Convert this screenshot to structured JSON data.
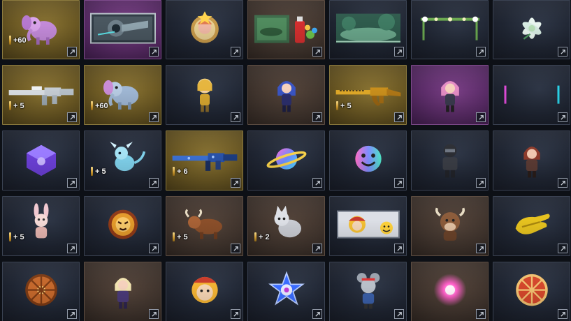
{
  "colors": {
    "tier_blue": "#1f2532",
    "tier_gold": "#6d5a24",
    "tier_purple": "#5b2c68",
    "tier_brown": "#41352e",
    "quantity_text": "#f2f2f2"
  },
  "items": [
    {
      "tier": "gold",
      "icon": "pink-elephant-pet-icon",
      "quantity": "+60"
    },
    {
      "tier": "purple",
      "icon": "weapon-crate-image-icon",
      "quantity": ""
    },
    {
      "tier": "blue",
      "icon": "character-medal-badge-icon",
      "quantity": ""
    },
    {
      "tier": "brown",
      "icon": "graffiti-spray-icon",
      "quantity": ""
    },
    {
      "tier": "blue",
      "icon": "forest-background-icon",
      "quantity": ""
    },
    {
      "tier": "blue",
      "icon": "flower-banner-icon",
      "quantity": ""
    },
    {
      "tier": "blue",
      "icon": "white-flower-icon",
      "quantity": ""
    },
    {
      "tier": "gold",
      "icon": "assault-rifle-white-icon",
      "quantity": "+ 5"
    },
    {
      "tier": "gold",
      "icon": "blue-elephant-pet-icon",
      "quantity": "+60"
    },
    {
      "tier": "blue",
      "icon": "golden-chibi-character-icon",
      "quantity": ""
    },
    {
      "tier": "brown",
      "icon": "blue-hair-chibi-character-icon",
      "quantity": ""
    },
    {
      "tier": "gold",
      "icon": "golden-ak-rifle-icon",
      "quantity": "+ 5"
    },
    {
      "tier": "purple",
      "icon": "pink-hair-chibi-character-icon",
      "quantity": ""
    },
    {
      "tier": "blue",
      "icon": "neon-banner-icon",
      "quantity": ""
    },
    {
      "tier": "blue",
      "icon": "purple-gem-cube-icon",
      "quantity": ""
    },
    {
      "tier": "blue",
      "icon": "ice-dragon-pet-icon",
      "quantity": "+ 5"
    },
    {
      "tier": "gold",
      "icon": "blue-camo-rifle-icon",
      "quantity": "+ 6"
    },
    {
      "tier": "blue",
      "icon": "rainbow-planet-icon",
      "quantity": ""
    },
    {
      "tier": "blue",
      "icon": "rainbow-smiley-icon",
      "quantity": ""
    },
    {
      "tier": "blue",
      "icon": "black-ops-soldier-icon",
      "quantity": ""
    },
    {
      "tier": "blue",
      "icon": "red-hair-soldier-icon",
      "quantity": ""
    },
    {
      "tier": "blue",
      "icon": "bunny-girl-pet-icon",
      "quantity": "+ 5"
    },
    {
      "tier": "blue",
      "icon": "tiger-emblem-icon",
      "quantity": ""
    },
    {
      "tier": "brown",
      "icon": "ox-pet-icon",
      "quantity": "+ 5"
    },
    {
      "tier": "brown",
      "icon": "grey-cat-pet-icon",
      "quantity": "+ 2"
    },
    {
      "tier": "blue",
      "icon": "monkey-king-card-icon",
      "quantity": ""
    },
    {
      "tier": "brown",
      "icon": "cow-mascot-icon",
      "quantity": ""
    },
    {
      "tier": "blue",
      "icon": "golden-glove-icon",
      "quantity": ""
    },
    {
      "tier": "blue",
      "icon": "compass-wheel-icon",
      "quantity": ""
    },
    {
      "tier": "brown",
      "icon": "elf-girl-chibi-icon",
      "quantity": ""
    },
    {
      "tier": "blue",
      "icon": "monkey-king-head-icon",
      "quantity": ""
    },
    {
      "tier": "blue",
      "icon": "blue-star-emblem-icon",
      "quantity": ""
    },
    {
      "tier": "blue",
      "icon": "grey-mouse-chibi-icon",
      "quantity": ""
    },
    {
      "tier": "brown",
      "icon": "pink-energy-orb-icon",
      "quantity": ""
    },
    {
      "tier": "blue",
      "icon": "pizza-wheel-icon",
      "quantity": ""
    }
  ]
}
